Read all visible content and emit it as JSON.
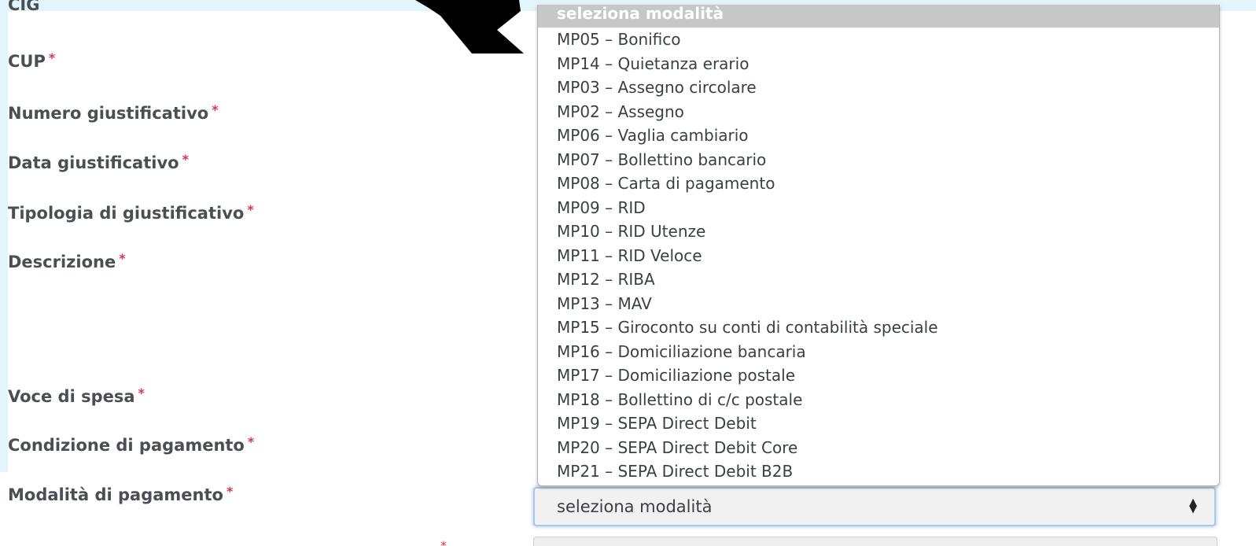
{
  "form": {
    "fields": [
      {
        "label": "CIG",
        "required": ""
      },
      {
        "label": "CUP",
        "required": "*"
      },
      {
        "label": "Numero giustificativo",
        "required": "*"
      },
      {
        "label": "Data giustificativo",
        "required": "*"
      },
      {
        "label": "Tipologia di giustificativo",
        "required": "*"
      },
      {
        "label": "Descrizione",
        "required": "*"
      },
      {
        "label": "Voce di spesa",
        "required": "*"
      },
      {
        "label": "Condizione di pagamento",
        "required": "*"
      },
      {
        "label": "Modalità di pagamento",
        "required": "*"
      }
    ],
    "next_required": "*"
  },
  "payment_select": {
    "value": "seleziona modalità",
    "arrow_icon": "up-down-arrows-icon",
    "options": [
      "seleziona modalità",
      "MP05 – Bonifico",
      "MP14 – Quietanza erario",
      "MP03 – Assegno circolare",
      "MP02 – Assegno",
      "MP06 – Vaglia cambiario",
      "MP07 – Bollettino bancario",
      "MP08 – Carta di pagamento",
      "MP09 – RID",
      "MP10 – RID Utenze",
      "MP11 – RID Veloce",
      "MP12 – RIBA",
      "MP13 – MAV",
      "MP15 – Giroconto su conti di contabilità speciale",
      "MP16 – Domiciliazione bancaria",
      "MP17 – Domiciliazione postale",
      "MP18 – Bollettino di c/c postale",
      "MP19 – SEPA Direct Debit",
      "MP20 – SEPA Direct Debit Core",
      "MP21 – SEPA Direct Debit B2B"
    ],
    "highlighted_index": 0
  },
  "colors": {
    "required_marker": "#d9364c",
    "highlight_band": "#e3f5fb",
    "focus_border": "#a8c8e8",
    "selected_option_bg": "#c7c7c7"
  }
}
